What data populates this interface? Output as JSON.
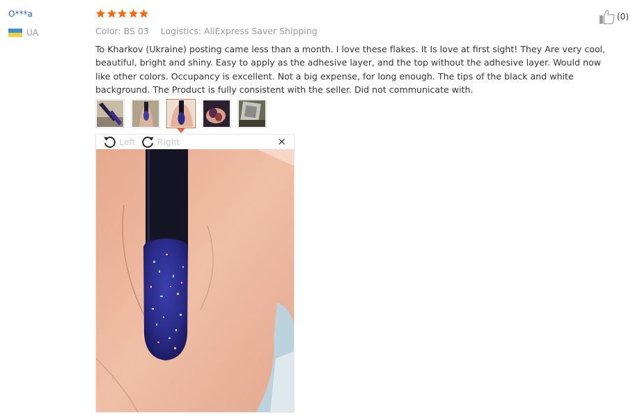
{
  "reviewer": {
    "name": "O***a",
    "country_code": "UA"
  },
  "rating": {
    "stars": 5,
    "max": 5
  },
  "meta": {
    "color": "Color: BS 03",
    "logistics": "Logistics: AliExpress Saver Shipping"
  },
  "review": {
    "text": "To Kharkov (Ukraine) posting came less than a month. I love these flakes. It Is love at first sight! They Are very cool, beautiful, bright and shiny. Easy to apply as the adhesive layer, and the top without the adhesive layer. Would now like other colors. Occupancy is excellent. Not a big expense, for long enough. The tips of the black and white background. The Product is fully consistent with the seller. Did not communicate with."
  },
  "helpful": {
    "count": "(0)",
    "icon": "thumbs-up-icon"
  },
  "photos": {
    "thumbnails": [
      "photo-1",
      "photo-2",
      "photo-3",
      "photo-4",
      "photo-5"
    ],
    "active_index": 2
  },
  "viewer": {
    "rotate_left_label": "Left",
    "rotate_right_label": "Right",
    "close_label": "×"
  },
  "colors": {
    "star": "#f96a0e",
    "accent_border": "#e8663b",
    "name_link": "#2a6ab8",
    "muted": "#999999"
  }
}
